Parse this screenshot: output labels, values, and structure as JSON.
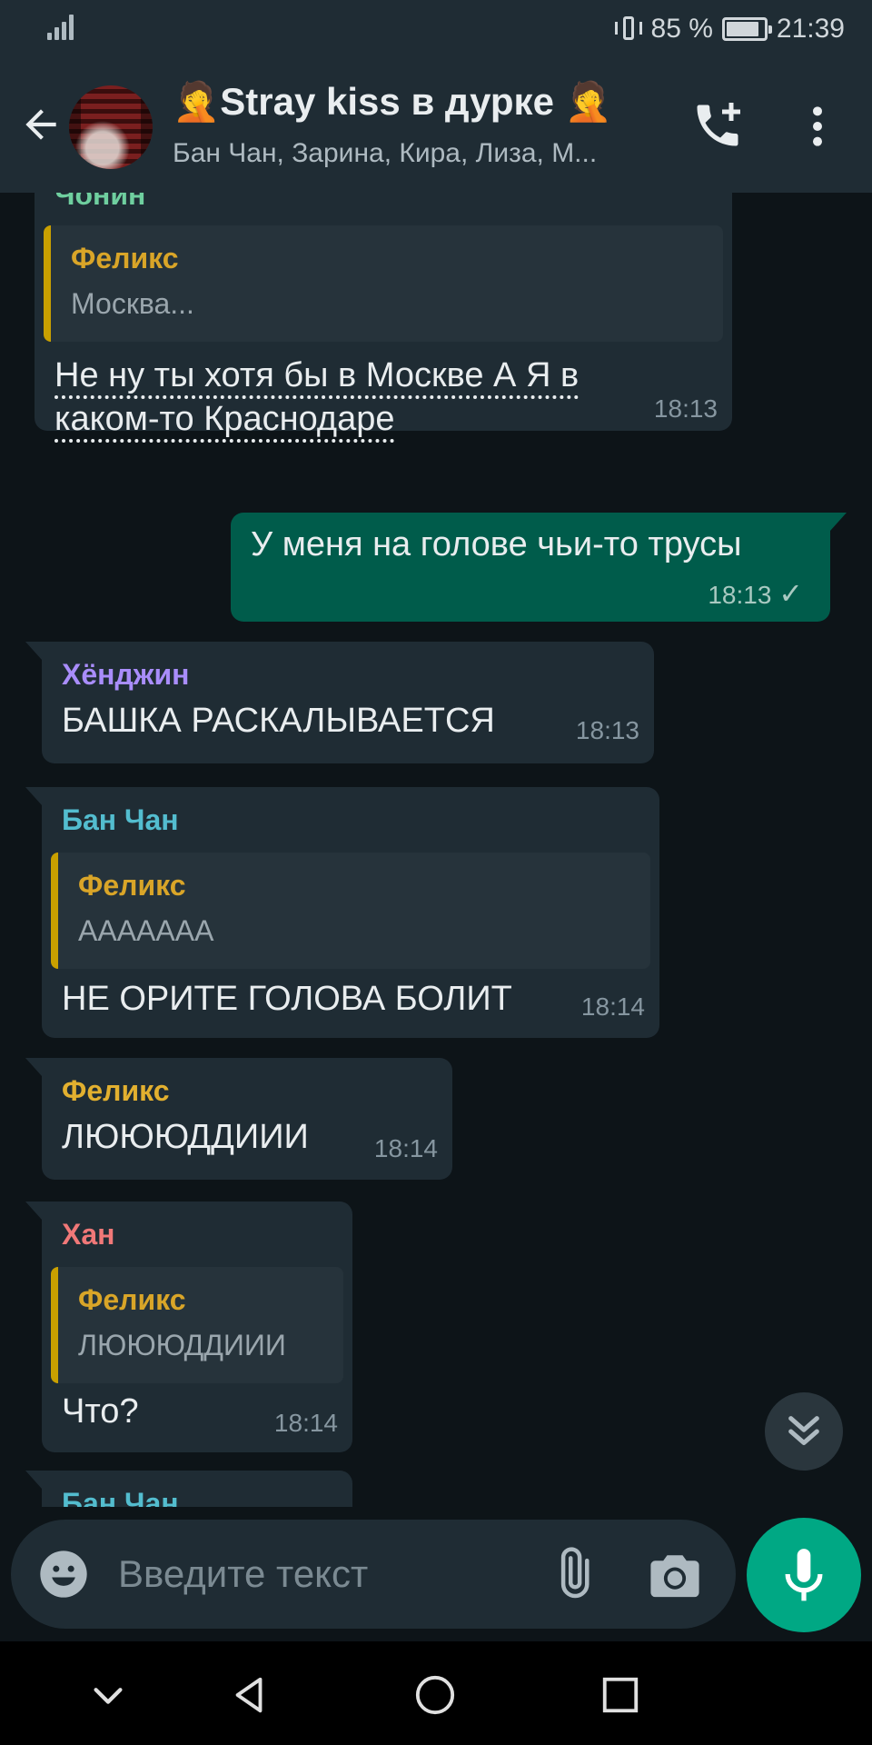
{
  "status_bar": {
    "battery": "85 %",
    "time": "21:39",
    "battery_level": 0.85
  },
  "header": {
    "title": "🤦Stray kiss в дурке 🤦",
    "subtitle": "Бан Чан, Зарина, Кира, Лиза, М..."
  },
  "messages": [
    {
      "sender": "Чонин",
      "sender_color": "#6fcf9f",
      "quote_name": "Феликс",
      "quote_text": "Москва...",
      "line1": "Не ну  ты хотя бы в Москве А Я в",
      "line2": "каком-то Краснодаре",
      "time": "18:13"
    },
    {
      "text": "У меня на голове чьи-то трусы",
      "time": "18:13",
      "status": "✓"
    },
    {
      "sender": "Хёнджин",
      "sender_color": "#a98dfb",
      "text": "БАШКА РАСКАЛЫВАЕТСЯ",
      "time": "18:13"
    },
    {
      "sender": "Бан Чан",
      "sender_color": "#53bdcf",
      "quote_name": "Феликс",
      "quote_text": "ААААААА",
      "text": "НЕ ОРИТЕ ГОЛОВА БОЛИТ",
      "time": "18:14"
    },
    {
      "sender": "Феликс",
      "sender_color": "#e2b02f",
      "text": "ЛЮЮЮДДИИИ",
      "time": "18:14"
    },
    {
      "sender": "Хан",
      "sender_color": "#f07878",
      "quote_name": "Феликс",
      "quote_text": "ЛЮЮЮДДИИИ",
      "text": "Что?",
      "time": "18:14"
    },
    {
      "sender": "Бан Чан",
      "sender_color": "#53bdcf"
    }
  ],
  "input": {
    "placeholder": "Введите текст"
  },
  "colors": {
    "accent": "#00a884",
    "outgoing": "#005c4b",
    "incoming": "#1f2c34",
    "background": "#0d1418"
  }
}
